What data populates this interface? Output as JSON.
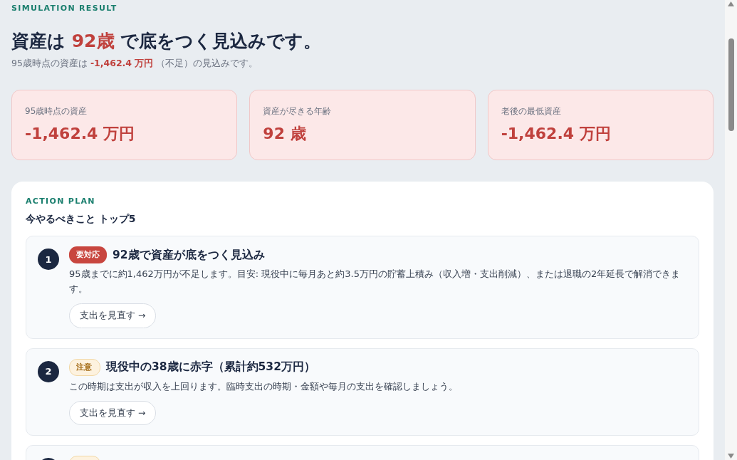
{
  "eyebrow": "SIMULATION RESULT",
  "headline": {
    "before": "資産は",
    "highlight": "92歳",
    "after": "で底をつく見込みです。"
  },
  "summary": {
    "before": "95歳時点の資産は",
    "highlight": "-1,462.4 万円",
    "after": "（不足）の見込みです。"
  },
  "stats": [
    {
      "label": "95歳時点の資産",
      "value": "-1,462.4 万円"
    },
    {
      "label": "資産が尽きる年齢",
      "value": "92 歳"
    },
    {
      "label": "老後の最低資産",
      "value": "-1,462.4 万円"
    }
  ],
  "action_plan": {
    "eyebrow": "ACTION PLAN",
    "title": "今やるべきこと トップ5",
    "items": [
      {
        "number": "1",
        "kind": "urgent",
        "badge": "要対応",
        "title": "92歳で資産が底をつく見込み",
        "description": "95歳までに約1,462万円が不足します。目安: 現役中に毎月あと約3.5万円の貯蓄上積み（収入増・支出削減）、または退職の2年延長で解消できます。",
        "button": "支出を見直す →"
      },
      {
        "number": "2",
        "kind": "caution",
        "badge": "注意",
        "title": "現役中の38歳に赤字（累計約532万円）",
        "description": "この時期は支出が収入を上回ります。臨時支出の時期・金額や毎月の支出を確認しましょう。",
        "button": "支出を見直す →"
      },
      {
        "kind": "caution"
      }
    ]
  }
}
